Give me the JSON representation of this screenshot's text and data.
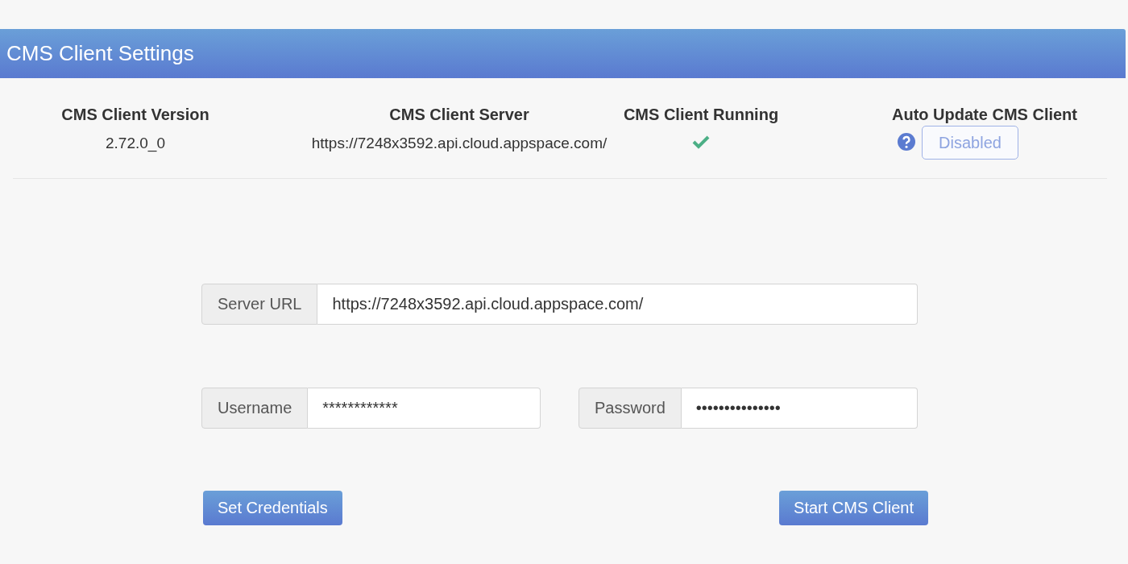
{
  "header": {
    "title": "CMS Client Settings"
  },
  "info": {
    "columns": [
      {
        "kind": "text",
        "heading": "CMS Client Version",
        "value": "2.72.0_0"
      },
      {
        "kind": "text",
        "heading": "CMS Client Server",
        "value": "https://7248x3592.api.cloud.appspace.com/"
      },
      {
        "kind": "status",
        "heading": "CMS Client Running",
        "running": true
      },
      {
        "kind": "toggle",
        "heading": "Auto Update CMS Client",
        "button": "Disabled",
        "enabled": false
      }
    ]
  },
  "form": {
    "server_url": {
      "label": "Server URL",
      "value": "https://7248x3592.api.cloud.appspace.com/"
    },
    "username": {
      "label": "Username",
      "value": "************"
    },
    "password": {
      "label": "Password",
      "value": "•••••••••••••••"
    }
  },
  "buttons": [
    {
      "label": "Set Credentials"
    },
    {
      "label": "Start CMS Client"
    }
  ]
}
